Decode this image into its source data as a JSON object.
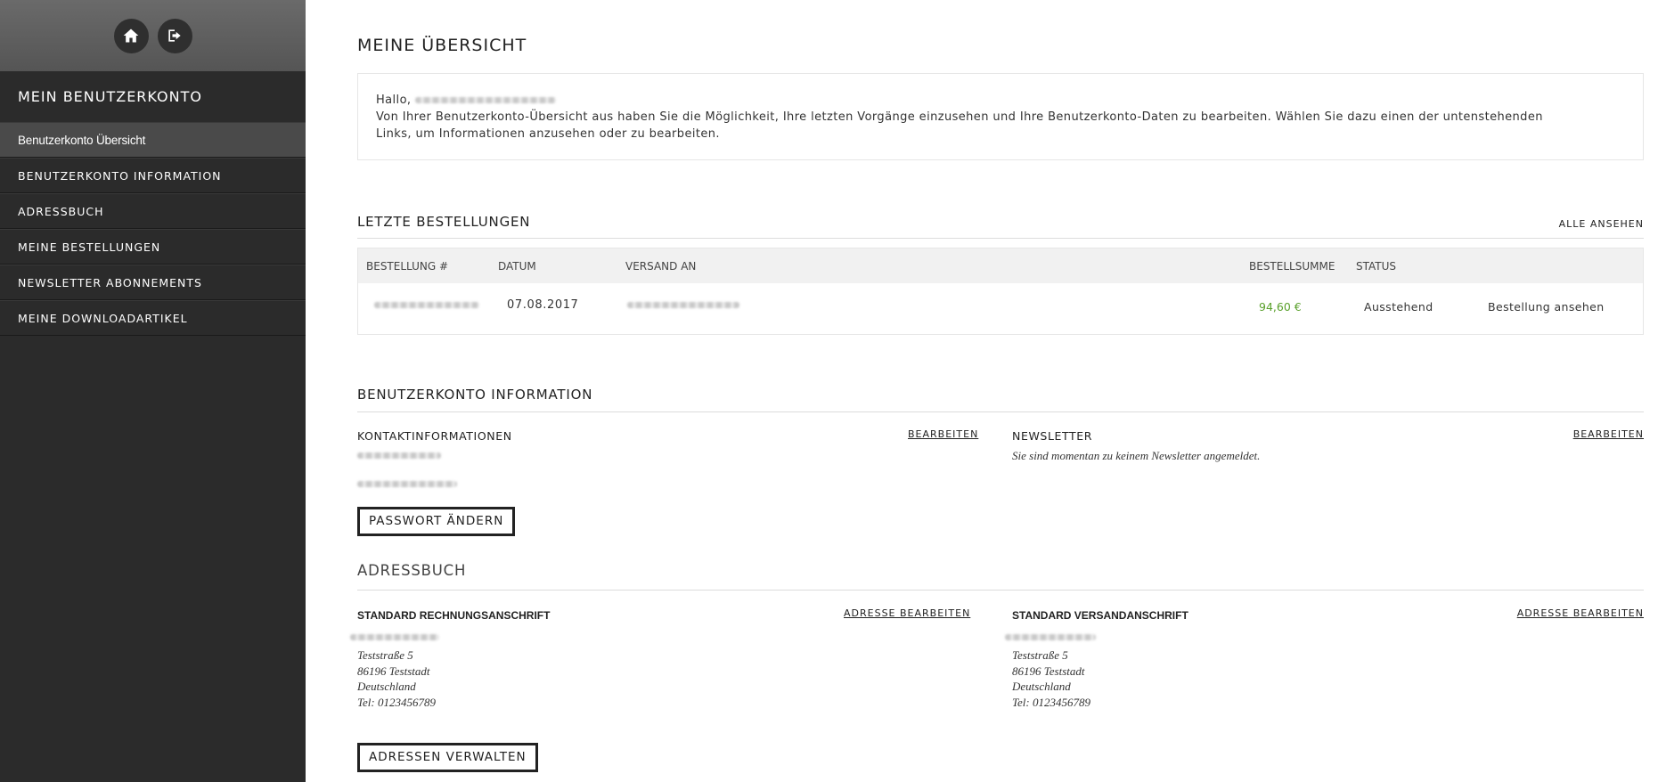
{
  "sidebar": {
    "title": "MEIN BENUTZERKONTO",
    "items": [
      {
        "label": "Benutzerkonto Übersicht",
        "active": true
      },
      {
        "label": "BENUTZERKONTO INFORMATION"
      },
      {
        "label": "ADRESSBUCH"
      },
      {
        "label": "MEINE BESTELLUNGEN"
      },
      {
        "label": "NEWSLETTER ABONNEMENTS"
      },
      {
        "label": "MEINE DOWNLOADARTIKEL"
      }
    ],
    "icons": [
      "home-icon",
      "logout-icon"
    ]
  },
  "main": {
    "title": "MEINE ÜBERSICHT",
    "welcome": {
      "greeting": "Hallo,",
      "text": "Von Ihrer Benutzerkonto-Übersicht aus haben Sie die Möglichkeit, Ihre letzten Vorgänge einzusehen und Ihre Benutzerkonto-Daten zu bearbeiten. Wählen Sie dazu einen der untenstehenden Links, um Informationen anzusehen oder zu bearbeiten."
    },
    "recent_orders": {
      "title": "LETZTE BESTELLUNGEN",
      "view_all": "ALLE ANSEHEN",
      "columns": [
        "BESTELLUNG #",
        "DATUM",
        "VERSAND AN",
        "BESTELLSUMME",
        "STATUS"
      ],
      "rows": [
        {
          "date": "07.08.2017",
          "total": "94,60 €",
          "status": "Ausstehend",
          "action": "Bestellung ansehen"
        }
      ],
      "total_color": "#5aa02c"
    },
    "account_info": {
      "title": "BENUTZERKONTO INFORMATION",
      "contact_label": "KONTAKTINFORMATIONEN",
      "contact_edit": "BEARBEITEN",
      "newsletter_label": "NEWSLETTER",
      "newsletter_edit": "BEARBEITEN",
      "newsletter_text": "Sie sind momentan zu keinem Newsletter angemeldet.",
      "change_password": "PASSWORT ÄNDERN"
    },
    "address_book": {
      "title": "ADRESSBUCH",
      "billing_label": "STANDARD RECHNUNGSANSCHRIFT",
      "billing_edit": "ADRESSE BEARBEITEN",
      "billing_lines": [
        "Teststraße 5",
        "86196 Teststadt",
        "Deutschland",
        "Tel: 0123456789"
      ],
      "shipping_label": "STANDARD VERSANDANSCHRIFT",
      "shipping_edit": "ADRESSE BEARBEITEN",
      "shipping_lines": [
        "Teststraße 5",
        "86196 Teststadt",
        "Deutschland",
        "Tel: 0123456789"
      ],
      "manage": "ADRESSEN VERWALTEN"
    }
  }
}
